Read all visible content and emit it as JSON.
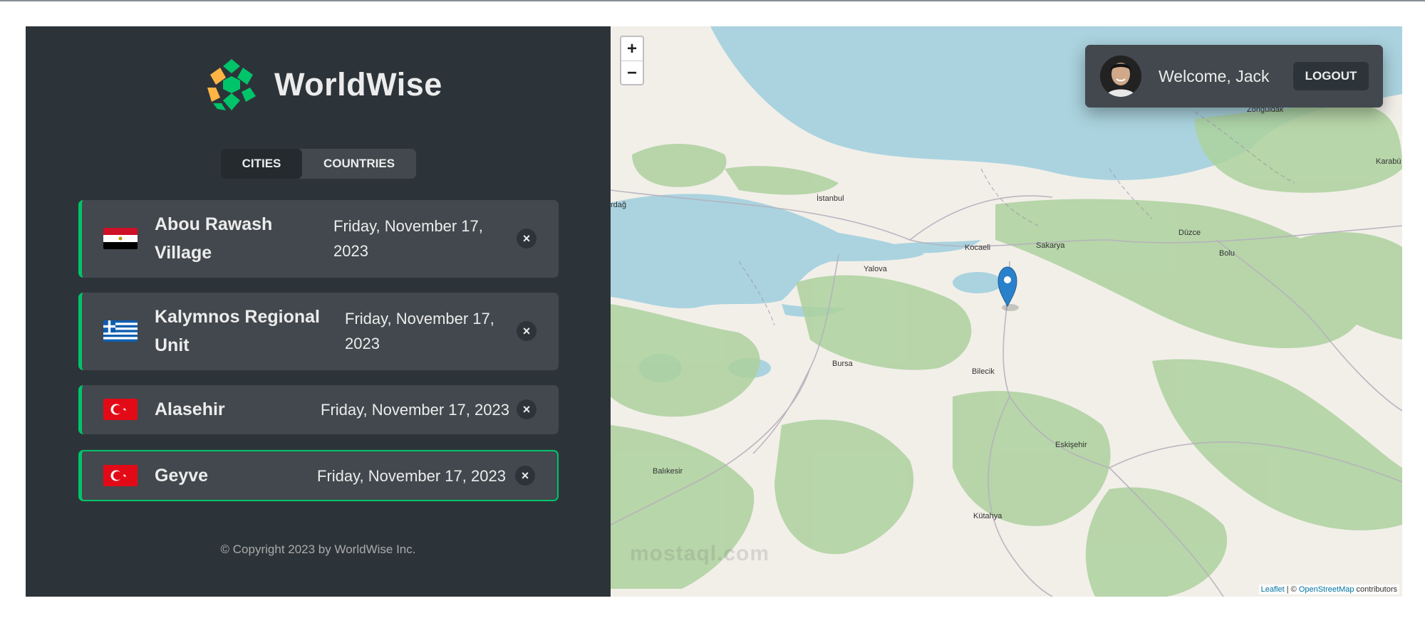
{
  "app": {
    "name": "WorldWise"
  },
  "tabs": [
    {
      "label": "Cities",
      "active": true
    },
    {
      "label": "Countries",
      "active": false
    }
  ],
  "cities": [
    {
      "flag": "egypt",
      "name_line1": "Abou Rawash",
      "name_line2": "Village",
      "date_line1": "Friday, November 17,",
      "date_line2": "2023",
      "active": false
    },
    {
      "flag": "greece",
      "name_line1": "Kalymnos Regional",
      "name_line2": "Unit",
      "date_line1": "Friday, November 17,",
      "date_line2": "2023",
      "active": false
    },
    {
      "flag": "turkey",
      "name": "Alasehir",
      "date": "Friday, November 17, 2023",
      "active": false
    },
    {
      "flag": "turkey",
      "name": "Geyve",
      "date": "Friday, November 17, 2023",
      "active": true
    }
  ],
  "delete_symbol": "×",
  "footer": {
    "copyright": "© Copyright 2023 by WorldWise Inc."
  },
  "map": {
    "zoom_in": "+",
    "zoom_out": "−",
    "labels": [
      "İstanbul",
      "Kocaeli",
      "Sakarya",
      "Düzce",
      "Bolu",
      "Yalova",
      "Bursa",
      "Bilecik",
      "Eskişehir",
      "Balıkesir",
      "Kütahya",
      "Zonguldak",
      "Karabü",
      "rdağ"
    ],
    "attribution": {
      "leaflet": "Leaflet",
      "separator": " | © ",
      "osm": "OpenStreetMap",
      "suffix": " contributors"
    },
    "watermark": "mostaql.com"
  },
  "user": {
    "welcome": "Welcome, Jack",
    "logout": "Logout"
  },
  "colors": {
    "sidebar_bg": "#2d3439",
    "item_bg": "#42484d",
    "accent_green": "#00c46a",
    "sea": "#aad3df",
    "forest": "#add19e",
    "marker": "#2a81cb"
  }
}
